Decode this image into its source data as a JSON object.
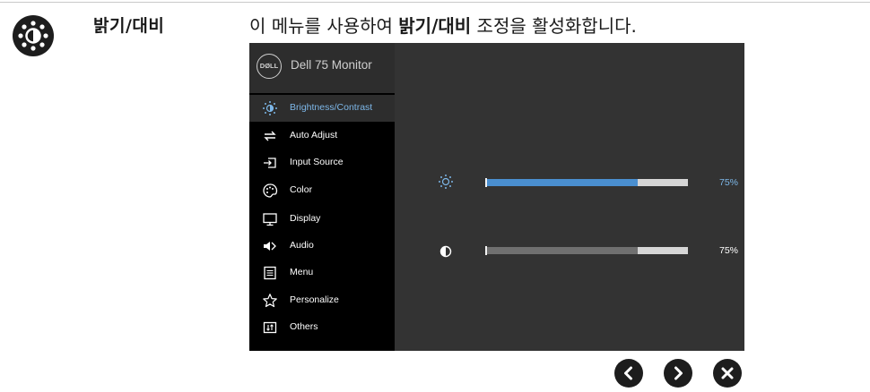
{
  "feature": {
    "title": "밝기/대비",
    "description_prefix": "이 메뉴를 사용하여 ",
    "description_bold": "밝기/대비",
    "description_suffix": " 조정을 활성화합니다."
  },
  "osd": {
    "logo_text": "DØLL",
    "model": "Dell 75 Monitor",
    "menu": [
      {
        "label": "Brightness/Contrast",
        "icon": "brightness-icon",
        "active": true
      },
      {
        "label": "Auto Adjust",
        "icon": "auto-adjust-icon"
      },
      {
        "label": "Input Source",
        "icon": "input-source-icon"
      },
      {
        "label": "Color",
        "icon": "color-palette-icon"
      },
      {
        "label": "Display",
        "icon": "display-icon"
      },
      {
        "label": "Audio",
        "icon": "audio-icon"
      },
      {
        "label": "Menu",
        "icon": "menu-icon"
      },
      {
        "label": "Personalize",
        "icon": "star-icon"
      },
      {
        "label": "Others",
        "icon": "others-icon"
      }
    ],
    "sliders": [
      {
        "name": "brightness",
        "icon": "brightness-icon",
        "value": 0.75,
        "value_label": "75%"
      },
      {
        "name": "contrast",
        "icon": "contrast-icon",
        "value": 0.75,
        "value_label": "75%"
      }
    ]
  },
  "colors": {
    "accent": "#7db7e8",
    "brightness_fill": "#4a8fd0",
    "contrast_fill": "#707070",
    "track": "#d6d6d6",
    "osd_bg": "#333333",
    "sidebar_bg": "#000000",
    "active_item_bg": "#2d2d2d"
  },
  "nav_buttons": [
    {
      "name": "previous-button",
      "icon": "chevron-left-icon"
    },
    {
      "name": "next-button",
      "icon": "chevron-right-icon"
    },
    {
      "name": "close-button",
      "icon": "close-icon"
    }
  ]
}
